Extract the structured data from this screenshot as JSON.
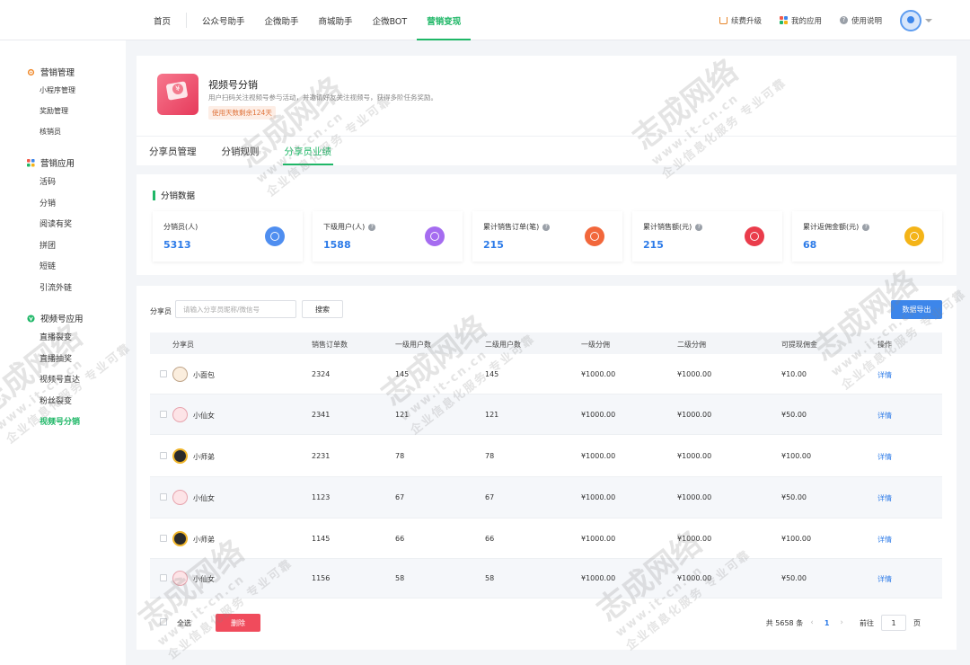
{
  "nav": {
    "items": [
      {
        "label": "首页",
        "active": false
      },
      {
        "label": "公众号助手",
        "active": false
      },
      {
        "label": "企微助手",
        "active": false
      },
      {
        "label": "商城助手",
        "active": false
      },
      {
        "label": "企微BOT",
        "active": false
      },
      {
        "label": "营销变现",
        "active": true
      }
    ],
    "upgrade": "续费升级",
    "my_apps": "我的应用",
    "help": "使用说明"
  },
  "sidebar": {
    "groups": [
      {
        "title": "营销管理",
        "icon": "gear-icon",
        "items": [
          "小程序管理",
          "奖励管理",
          "核销员"
        ]
      },
      {
        "title": "营销应用",
        "icon": "grid-icon",
        "items": [
          "活码",
          "分销",
          "阅读有奖",
          "拼团",
          "短链",
          "引流外链"
        ]
      },
      {
        "title": "视频号应用",
        "icon": "video-icon",
        "items": [
          "直播裂变",
          "直播抽奖",
          "视频号直达",
          "粉丝裂变",
          "视频号分销"
        ]
      }
    ],
    "active_item": "视频号分销"
  },
  "product": {
    "title": "视频号分销",
    "desc": "用户扫码关注视频号参与活动，并邀请好友关注视频号，获得多阶任务奖励。",
    "badge": "使用天数剩余124天"
  },
  "tabs": [
    "分享员管理",
    "分销规则",
    "分享员业绩"
  ],
  "active_tab": 2,
  "section_title": "分销数据",
  "stats": [
    {
      "label": "分销员(人)",
      "value": "5313",
      "help": false,
      "color": "#4f8ef0"
    },
    {
      "label": "下级用户(人)",
      "value": "1588",
      "help": true,
      "color": "#a56cf0"
    },
    {
      "label": "累计销售订单(笔)",
      "value": "215",
      "help": true,
      "color": "#f2673b"
    },
    {
      "label": "累计销售额(元)",
      "value": "215",
      "help": true,
      "color": "#ea3c4b"
    },
    {
      "label": "累计返佣金额(元)",
      "value": "68",
      "help": true,
      "color": "#f4b418"
    }
  ],
  "filter": {
    "label": "分享员",
    "placeholder": "请输入分享员昵称/微信号",
    "search": "搜索",
    "export": "数据导出"
  },
  "table": {
    "headers": [
      "分享员",
      "销售订单数",
      "一级用户数",
      "二级用户数",
      "一级分佣",
      "二级分佣",
      "可提现佣金",
      "操作"
    ],
    "rows": [
      {
        "name": "小面包",
        "orders": "2324",
        "l1": "145",
        "l2": "145",
        "c1": "¥1000.00",
        "c2": "¥1000.00",
        "withdraw": "¥10.00",
        "action": "详情",
        "avatar": "a1"
      },
      {
        "name": "小仙女",
        "orders": "2341",
        "l1": "121",
        "l2": "121",
        "c1": "¥1000.00",
        "c2": "¥1000.00",
        "withdraw": "¥50.00",
        "action": "详情",
        "avatar": "a2"
      },
      {
        "name": "小师弟",
        "orders": "2231",
        "l1": "78",
        "l2": "78",
        "c1": "¥1000.00",
        "c2": "¥1000.00",
        "withdraw": "¥100.00",
        "action": "详情",
        "avatar": "a3"
      },
      {
        "name": "小仙女",
        "orders": "1123",
        "l1": "67",
        "l2": "67",
        "c1": "¥1000.00",
        "c2": "¥1000.00",
        "withdraw": "¥50.00",
        "action": "详情",
        "avatar": "a2"
      },
      {
        "name": "小师弟",
        "orders": "1145",
        "l1": "66",
        "l2": "66",
        "c1": "¥1000.00",
        "c2": "¥1000.00",
        "withdraw": "¥100.00",
        "action": "详情",
        "avatar": "a3"
      },
      {
        "name": "小仙女",
        "orders": "1156",
        "l1": "58",
        "l2": "58",
        "c1": "¥1000.00",
        "c2": "¥1000.00",
        "withdraw": "¥50.00",
        "action": "详情",
        "avatar": "a2"
      }
    ]
  },
  "footer": {
    "select_all": "全选",
    "delete": "删除",
    "total": "共 5658 条",
    "prev": "‹",
    "page": "1",
    "next": "›",
    "goto": "前往",
    "page_input": "1",
    "page_unit": "页"
  },
  "watermark": {
    "big": "志成网络",
    "url": "www.it-cn.cn",
    "sub": "企业信息化服务 专业可靠"
  }
}
